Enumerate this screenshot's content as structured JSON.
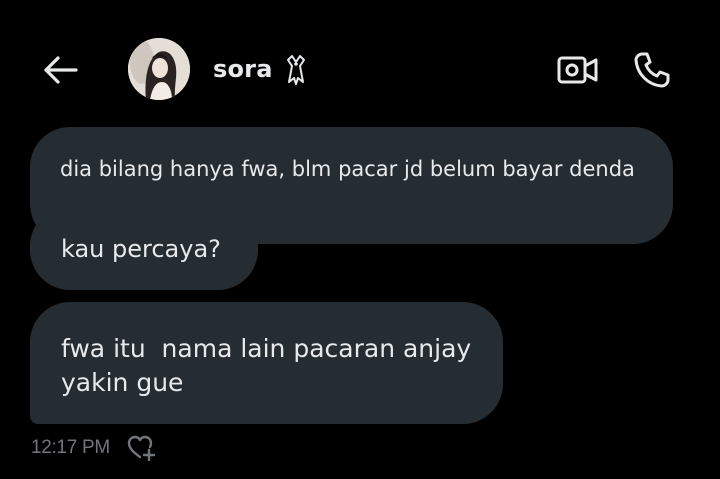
{
  "header": {
    "back_icon": "arrow-left-icon",
    "contact_name": "sora",
    "video_icon": "video-camera-icon",
    "call_icon": "phone-icon"
  },
  "messages": [
    {
      "text": "dia bilang hanya fwa, blm pacar jd belum bayar denda"
    },
    {
      "text": "kau percaya?"
    },
    {
      "lines": [
        "fwa itu  nama lain pacaran anjay",
        "yakin gue"
      ]
    }
  ],
  "meta": {
    "timestamp": "12:17 PM",
    "react_icon": "heart-plus-icon"
  },
  "colors": {
    "background": "#000000",
    "bubble": "#252c32",
    "text": "#e7e9ea",
    "muted": "#71767b"
  }
}
